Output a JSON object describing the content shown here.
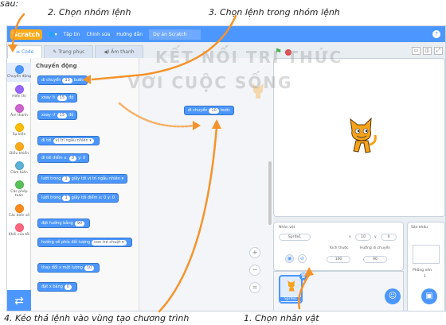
{
  "annotations": {
    "top_left_fragment": "sau:",
    "step2": "2. Chọn nhóm lệnh",
    "step3": "3. Chọn lệnh trong nhóm lệnh",
    "step4": "4. Kéo thả lệnh vào vùng tạo chương trình",
    "step1": "1. Chọn nhân vật"
  },
  "watermark": {
    "line1": "KẾT NỐI TRI THỨC",
    "line2": "VỚI CUỘC SỐNG"
  },
  "menubar": {
    "logo": "Scratch",
    "language_icon": "globe-icon",
    "file": "Tập tin",
    "edit": "Chỉnh sửa",
    "tutorials": "Hướng dẫn",
    "project_title": "Dự án Scratch",
    "help_icon": "?"
  },
  "tabs": [
    {
      "label": "Code",
      "icon": "code-icon"
    },
    {
      "label": "Trang phục",
      "icon": "brush-icon"
    },
    {
      "label": "Âm thanh",
      "icon": "speaker-icon"
    }
  ],
  "categories": [
    {
      "label": "Chuyển động",
      "color": "#4c97ff"
    },
    {
      "label": "Hiển thị",
      "color": "#9966ff"
    },
    {
      "label": "Âm thanh",
      "color": "#cf63cf"
    },
    {
      "label": "Sự kiện",
      "color": "#ffbf00"
    },
    {
      "label": "Điều khiển",
      "color": "#ffab19"
    },
    {
      "label": "Cảm biến",
      "color": "#5cb1d6"
    },
    {
      "label": "Các phép toán",
      "color": "#59c059"
    },
    {
      "label": "Các biến số",
      "color": "#ff8c1a"
    },
    {
      "label": "Khối của tôi",
      "color": "#ff6680"
    }
  ],
  "palette": {
    "heading": "Chuyển động",
    "blocks": [
      {
        "text": "di chuyển",
        "n": "10",
        "after": "bước"
      },
      {
        "text": "xoay ↻",
        "n": "15",
        "after": "độ"
      },
      {
        "text": "xoay ↺",
        "n": "15",
        "after": "độ"
      },
      {
        "text": "đi tới",
        "n": "vị trí ngẫu nhiên ▾",
        "after": ""
      },
      {
        "text": "đi tới điểm x:",
        "n": "0",
        "after": "y: 0"
      },
      {
        "text": "lướt trong",
        "n": "1",
        "after": "giây tới vị trí ngẫu nhiên ▾"
      },
      {
        "text": "lướt trong",
        "n": "1",
        "after": "giây tới điểm x: 0 y: 0"
      },
      {
        "text": "đặt hướng bằng",
        "n": "90",
        "after": ""
      },
      {
        "text": "hướng về phía đối tượng",
        "n": "con trỏ chuột ▾",
        "after": ""
      },
      {
        "text": "thay đổi x một lượng",
        "n": "10",
        "after": ""
      },
      {
        "text": "đặt x bằng",
        "n": "0",
        "after": ""
      }
    ]
  },
  "code_area": {
    "block": {
      "text": "di chuyển",
      "n": "10",
      "after": "bước"
    }
  },
  "stage_controls": {
    "flag_icon": "green-flag-icon",
    "stop_icon": "stop-icon"
  },
  "sprite_info": {
    "label_sprite": "Nhân vật",
    "sprite_name": "Sprite1",
    "x_label": "x",
    "x_value": "10",
    "y_label": "y",
    "y_value": "0",
    "show_label": "Hiện",
    "size_label": "Kích thước",
    "size_value": "100",
    "direction_label": "Hướng di chuyển",
    "direction_value": "90"
  },
  "sprite_list": {
    "thumb_label": "Sprite1"
  },
  "stage_panel": {
    "title": "Sân khấu",
    "backdrops_label": "Phông nền",
    "backdrops_count": "1"
  }
}
